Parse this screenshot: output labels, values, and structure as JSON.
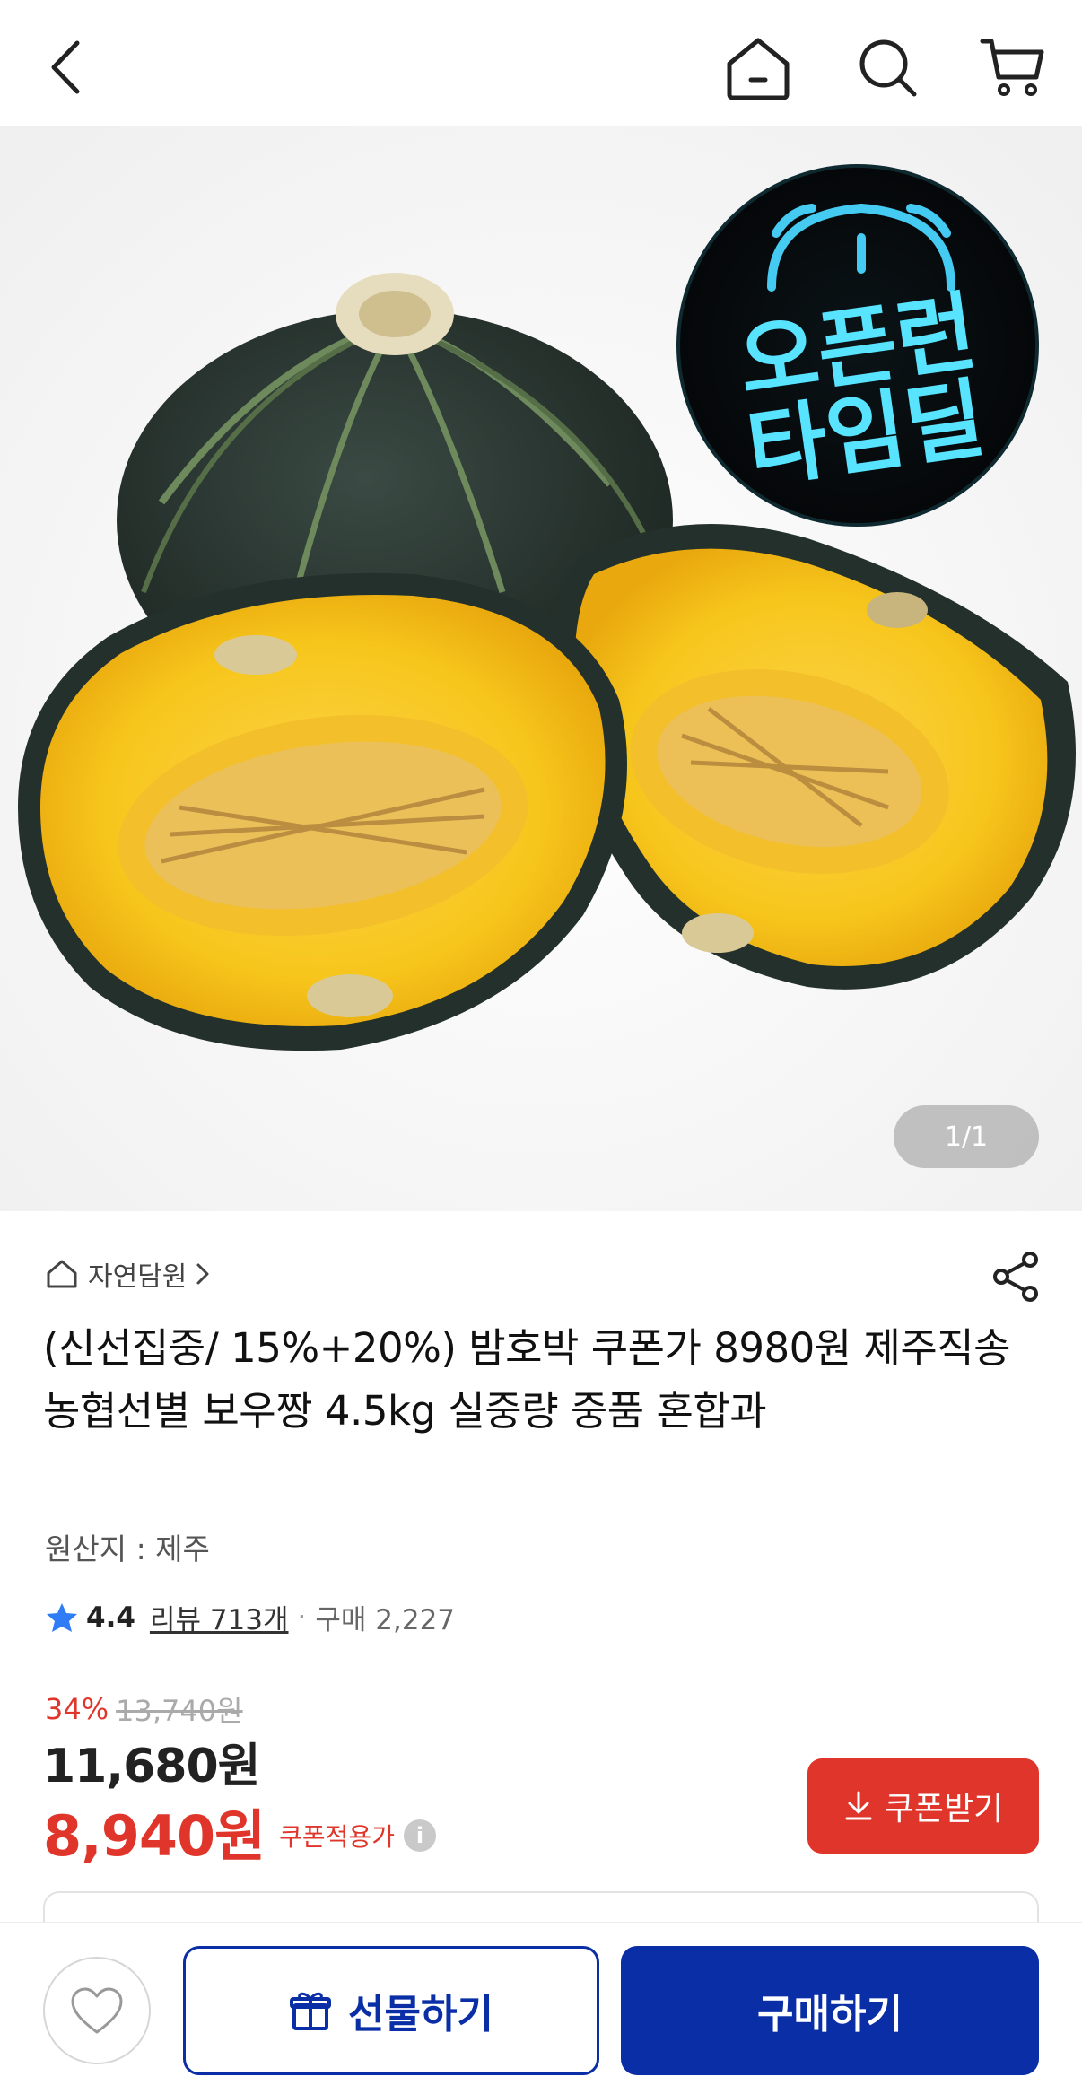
{
  "nav": {
    "back_icon": "chevron-left-icon",
    "home_icon": "home-icon",
    "search_icon": "search-icon",
    "cart_icon": "cart-icon"
  },
  "hero": {
    "badge_line1": "오픈런",
    "badge_line2": "타임딜",
    "counter": "1/1"
  },
  "product": {
    "brand": "자연담원",
    "title": "(신선집중/ 15%+20%) 밤호박 쿠폰가 8980원 제주직송 농협선별 보우짱 4.5kg 실중량 중품 혼합과",
    "origin": "원산지 : 제주",
    "rating": "4.4",
    "reviews": "리뷰 713개",
    "separator": "·",
    "purchases": "구매 2,227",
    "discount_rate": "34%",
    "original_price": "13,740원",
    "price": "11,680원",
    "coupon_price": "8,940원",
    "coupon_label": "쿠폰적용가",
    "coupon_button": "쿠폰받기"
  },
  "bottom": {
    "gift_label": "선물하기",
    "buy_label": "구매하기"
  },
  "colors": {
    "accent_red": "#e0352b",
    "primary_blue": "#0a2ea6",
    "star_blue": "#2f7cf6"
  }
}
